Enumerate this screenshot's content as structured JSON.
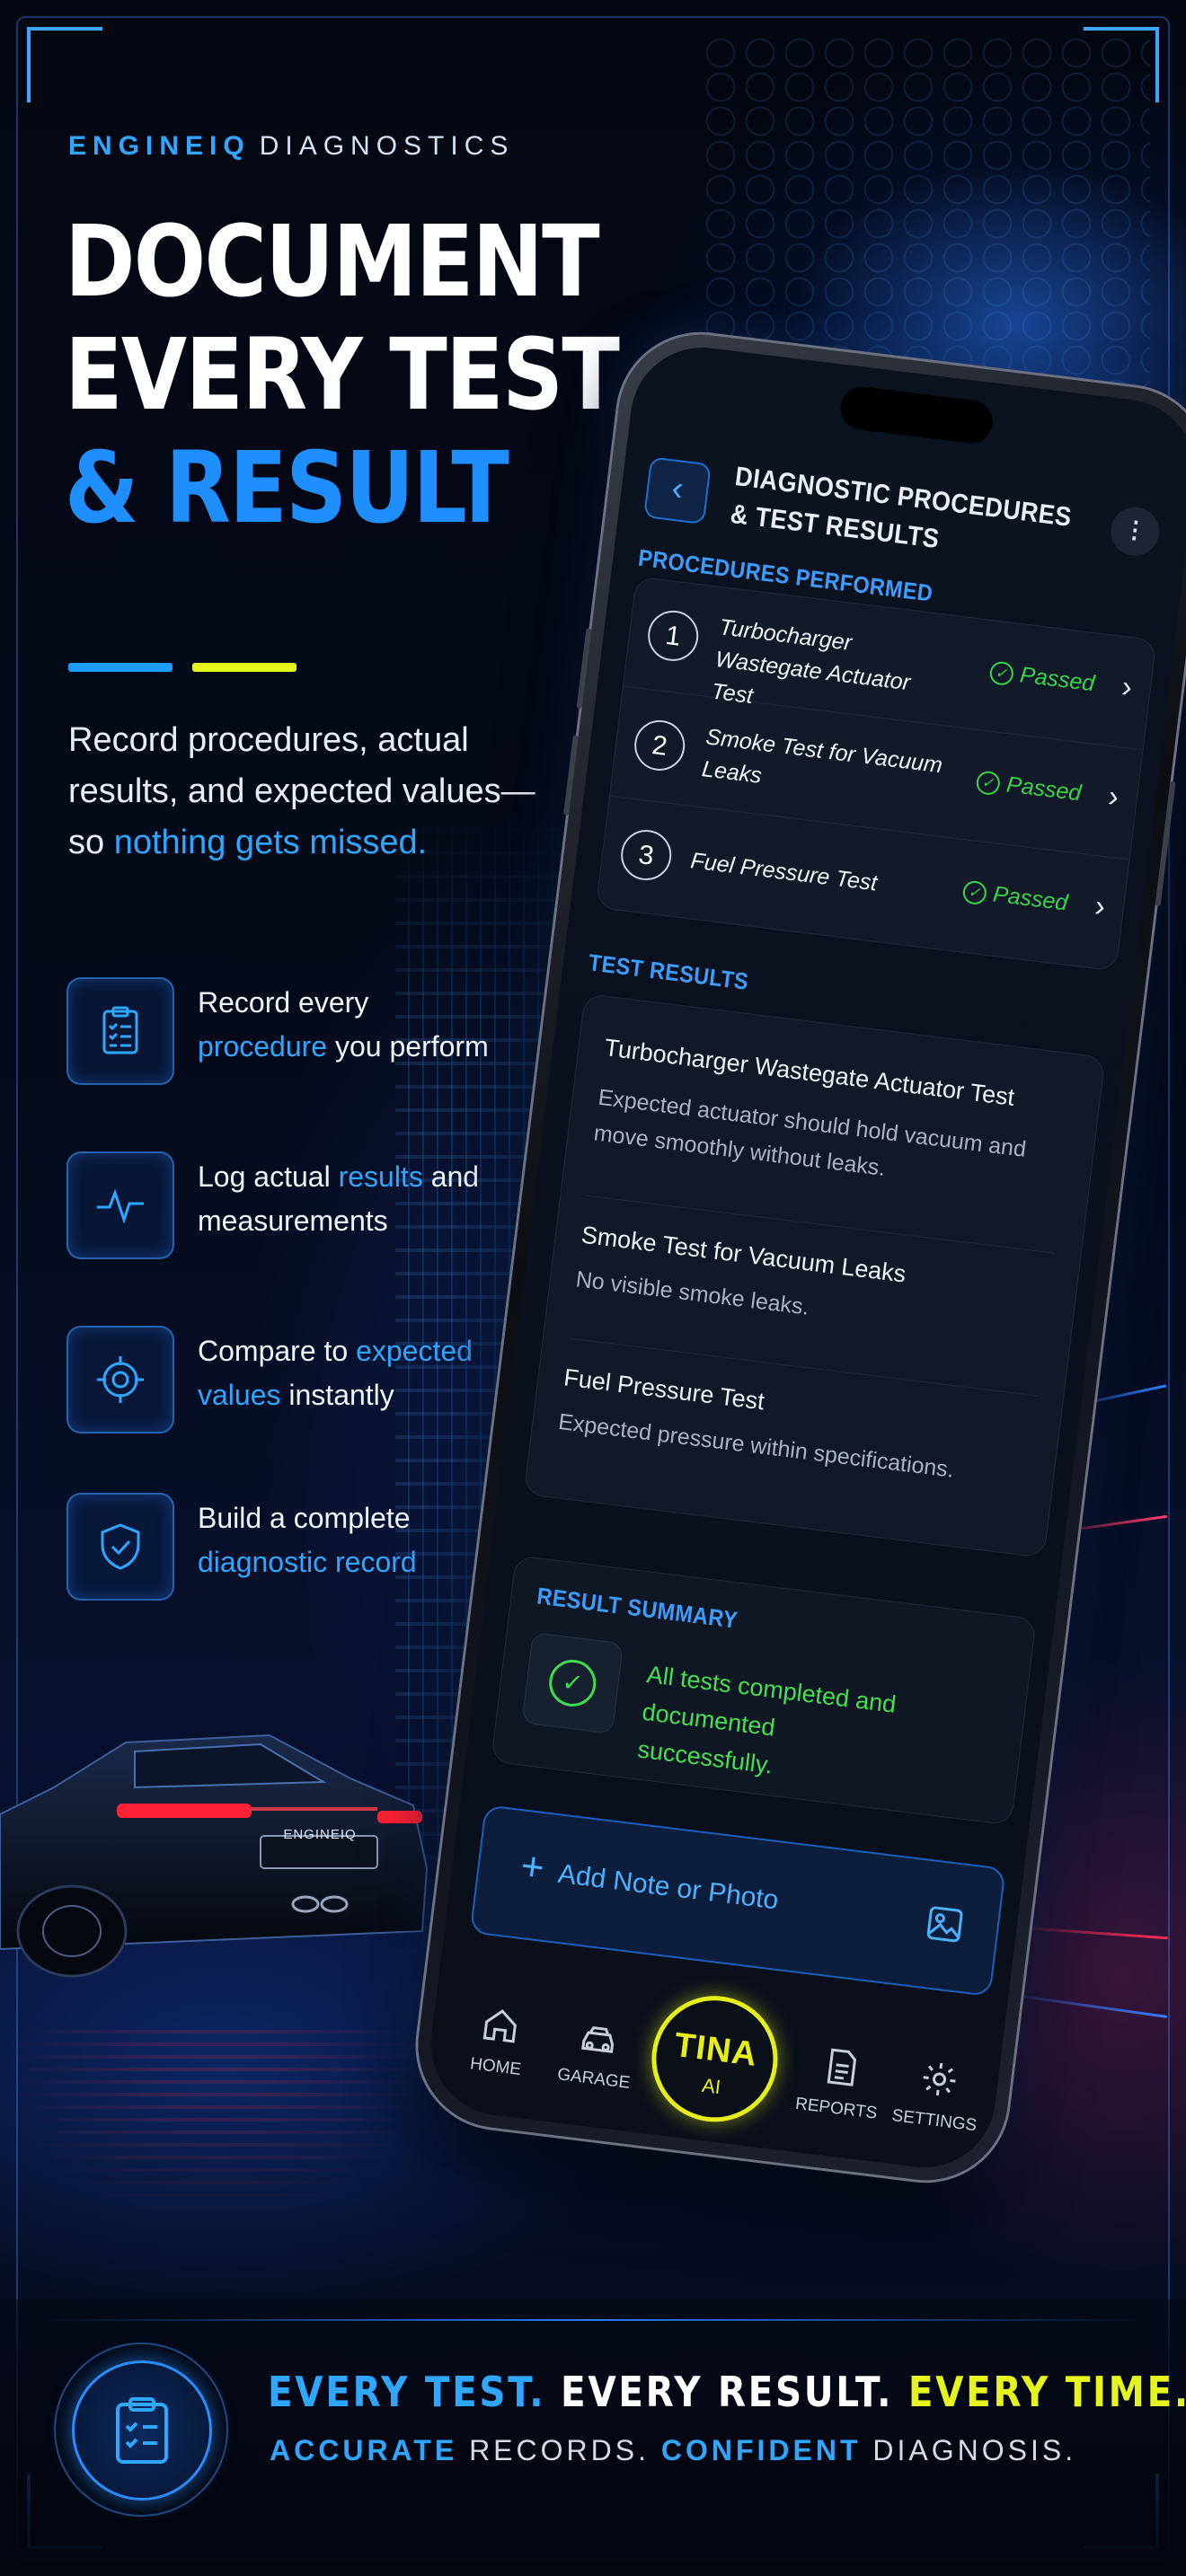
{
  "brand": {
    "name": "ENGINEIQ",
    "suffix": "DIAGNOSTICS"
  },
  "headline": {
    "line1": "DOCUMENT",
    "line2": "EVERY TEST",
    "line3": "& RESULT"
  },
  "intro": {
    "text": "Record procedures, actual results, and expected values—so ",
    "highlight": "nothing gets missed."
  },
  "features": [
    {
      "icon": "clipboard-checklist-icon",
      "pre": "Record every ",
      "highlight": "procedure",
      "post": " you perform"
    },
    {
      "icon": "pulse-wave-icon",
      "pre": "Log actual ",
      "highlight": "results",
      "post": " and measurements"
    },
    {
      "icon": "target-crosshair-icon",
      "pre": "Compare to ",
      "highlight": "expected values",
      "post": " instantly"
    },
    {
      "icon": "shield-check-icon",
      "pre": "Build a complete ",
      "highlight": "diagnostic record",
      "post": ""
    }
  ],
  "car": {
    "badge": "ENGINEIQ"
  },
  "app": {
    "title_line1": "DIAGNOSTIC PROCEDURES",
    "title_line2": "& TEST RESULTS",
    "procedures_label": "PROCEDURES PERFORMED",
    "procedures": [
      {
        "num": "1",
        "name": "Turbocharger Wastegate Actuator Test",
        "status": "Passed"
      },
      {
        "num": "2",
        "name": "Smoke Test for Vacuum Leaks",
        "status": "Passed"
      },
      {
        "num": "3",
        "name": "Fuel Pressure Test",
        "status": "Passed"
      }
    ],
    "results_label": "TEST RESULTS",
    "results": [
      {
        "title": "Turbocharger Wastegate Actuator Test",
        "desc": "Expected actuator should hold vacuum and move smoothly without leaks."
      },
      {
        "title": "Smoke Test for Vacuum Leaks",
        "desc": "No visible smoke leaks."
      },
      {
        "title": "Fuel Pressure Test",
        "desc": "Expected pressure within specifications."
      }
    ],
    "summary_label": "RESULT SUMMARY",
    "summary_text": "All tests completed and documented successfully.",
    "add_button": "Add Note or Photo",
    "tabs": {
      "home": "HOME",
      "garage": "GARAGE",
      "tina_line1": "TINA",
      "tina_line2": "AI",
      "reports": "REPORTS",
      "settings": "SETTINGS"
    }
  },
  "banner": {
    "line1_a": "EVERY TEST.",
    "line1_b": "EVERY RESULT.",
    "line1_c": "EVERY TIME.",
    "line2_a": "ACCURATE",
    "line2_b": " RECORDS. ",
    "line2_c": "CONFIDENT",
    "line2_d": " DIAGNOSIS."
  },
  "colors": {
    "accent_blue": "#2fa6ff",
    "accent_yellow": "#e6f41e",
    "passed_green": "#39d449"
  }
}
